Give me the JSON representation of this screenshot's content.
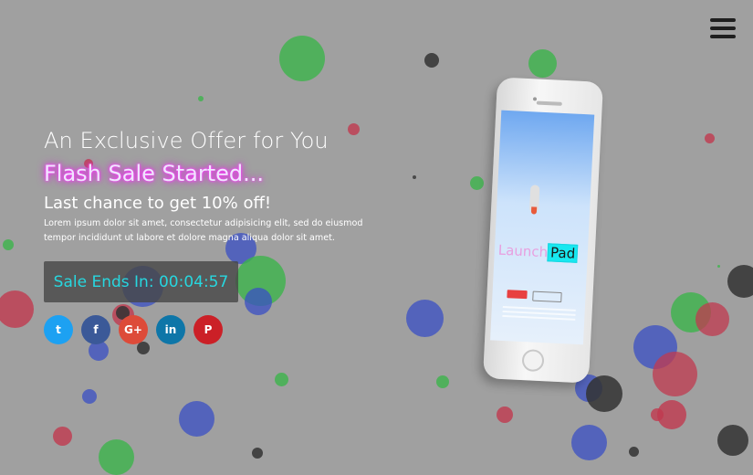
{
  "hero": {
    "title": "An Exclusive Offer for You",
    "headline": "Flash Sale Started...",
    "subheadline": "Last chance to get 10% off!",
    "body": "Lorem ipsum dolor sit amet, consectetur adipisicing elit, sed do eiusmod tempor incididunt ut labore et dolore magna aliqua dolor sit amet."
  },
  "countdown": {
    "label": "Sale Ends In: 00:04:57"
  },
  "social": [
    {
      "name": "twitter",
      "glyph": "t",
      "color": "#1da1f2"
    },
    {
      "name": "facebook",
      "glyph": "f",
      "color": "#3b5998"
    },
    {
      "name": "google-plus",
      "glyph": "G+",
      "color": "#dd4b39"
    },
    {
      "name": "linkedin",
      "glyph": "in",
      "color": "#0e76a8"
    },
    {
      "name": "pinterest",
      "glyph": "P",
      "color": "#cb2027"
    }
  ],
  "phone_app": {
    "brand_prefix": "Launch",
    "brand_suffix": "Pad"
  },
  "colors": {
    "background": "#a0a0a0",
    "accent_cyan": "#27d7df",
    "neon_pink": "#e100e6"
  }
}
